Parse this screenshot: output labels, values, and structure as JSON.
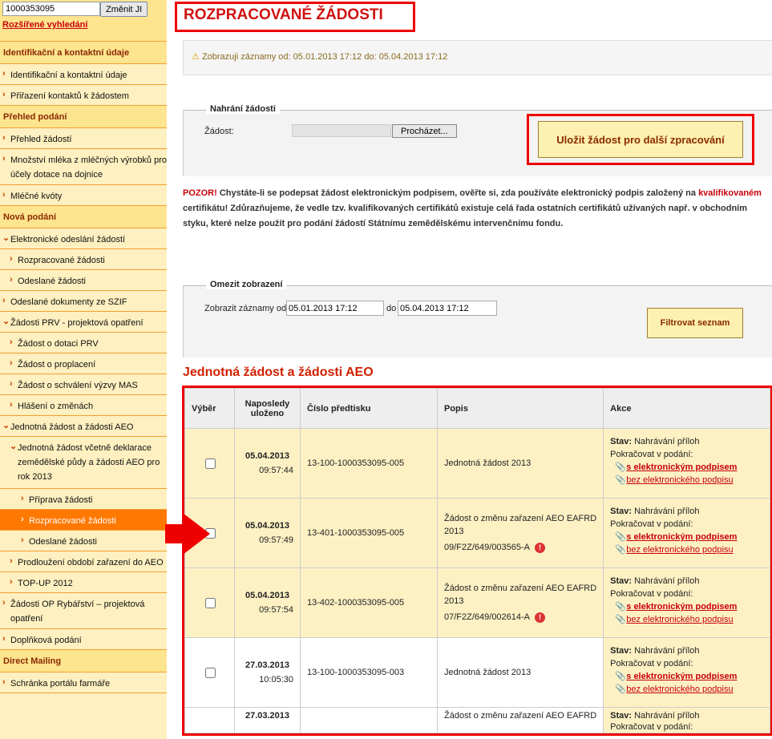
{
  "sidebar": {
    "ji_value": "1000353095",
    "change_button": "Změnit JI",
    "advanced_search": "Rozšířené vyhledání",
    "items": [
      {
        "type": "heading",
        "label": "Identifikační a kontaktní údaje"
      },
      {
        "type": "item",
        "level": 0,
        "label": "Identifikační a kontaktní údaje"
      },
      {
        "type": "item",
        "level": 0,
        "label": "Přiřazení kontaktů k žádostem"
      },
      {
        "type": "heading",
        "label": "Přehled podání"
      },
      {
        "type": "item",
        "level": 0,
        "label": "Přehled žádostí"
      },
      {
        "type": "item",
        "level": 0,
        "label": "Množství mléka z mléčných výrobků pro účely dotace na dojnice",
        "lines": 2
      },
      {
        "type": "item",
        "level": 0,
        "label": "Mléčné kvóty"
      },
      {
        "type": "heading",
        "label": "Nová podání"
      },
      {
        "type": "item",
        "level": 0,
        "label": "Elektronické odeslání žádostí",
        "expanded": true
      },
      {
        "type": "item",
        "level": 1,
        "label": "Rozpracované žádosti"
      },
      {
        "type": "item",
        "level": 1,
        "label": "Odeslané žádosti"
      },
      {
        "type": "item",
        "level": 0,
        "label": "Odeslané dokumenty ze SZIF"
      },
      {
        "type": "item",
        "level": 0,
        "label": "Žádosti PRV - projektová opatření",
        "expanded": true
      },
      {
        "type": "item",
        "level": 1,
        "label": "Žádost o dotaci PRV"
      },
      {
        "type": "item",
        "level": 1,
        "label": "Žádost o proplacení"
      },
      {
        "type": "item",
        "level": 1,
        "label": "Žádost o schválení výzvy MAS"
      },
      {
        "type": "item",
        "level": 1,
        "label": "Hlášení o změnách"
      },
      {
        "type": "item",
        "level": 0,
        "label": "Jednotná žádost a žádosti AEO",
        "expanded": true
      },
      {
        "type": "item",
        "level": 1,
        "label": "Jednotná žádost včetně deklarace zemědělské půdy a žádosti AEO pro rok 2013",
        "expanded": true,
        "lines": 3
      },
      {
        "type": "item",
        "level": 2,
        "label": "Příprava žádosti"
      },
      {
        "type": "item",
        "level": 2,
        "label": "Rozpracované žádosti",
        "active": true
      },
      {
        "type": "item",
        "level": 2,
        "label": "Odeslané žádosti"
      },
      {
        "type": "item",
        "level": 1,
        "label": "Prodloužení období zařazení do AEO"
      },
      {
        "type": "item",
        "level": 1,
        "label": "TOP-UP 2012"
      },
      {
        "type": "item",
        "level": 0,
        "label": "Žádosti OP Rybářství – projektová opatření",
        "lines": 2
      },
      {
        "type": "item",
        "level": 0,
        "label": "Doplňková podání"
      },
      {
        "type": "heading",
        "label": "Direct Mailing"
      },
      {
        "type": "item",
        "level": 0,
        "label": "Schránka portálu farmáře"
      }
    ]
  },
  "main": {
    "title": "ROZPRACOVANÉ ŽÁDOSTI",
    "info": "Zobrazuji záznamy od: 05.01.2013 17:12 do: 05.04.2013 17:12",
    "upload": {
      "legend": "Nahrání žádosti",
      "label": "Žádost:",
      "browse": "Procházet...",
      "save": "Uložit žádost pro další zpracování"
    },
    "warning": {
      "pozor": "POZOR!",
      "text1": " Chystáte-li se podepsat žádost elektronickým podpisem, ověřte si, zda používáte elektronický podpis založený na ",
      "link": "kvalifikovaném",
      "text2": " certifikátu! Zdůrazňujeme, že vedle tzv. kvalifikovaných certifikátů existuje celá řada ostatních certifikátů užívaných např. v obchodním styku, které nelze použít pro podání žádostí Státnímu zemědělskému intervenčnímu fondu."
    },
    "filter": {
      "legend": "Omezit zobrazení",
      "label": "Zobrazit záznamy od",
      "from": "05.01.2013 17:12",
      "to_label": "do",
      "to": "05.04.2013 17:12",
      "button": "Filtrovat seznam"
    },
    "section_title": "Jednotná žádost a žádosti AEO",
    "table": {
      "headers": [
        "Výběr",
        "Naposledy uloženo",
        "Číslo předtisku",
        "Popis",
        "Akce"
      ],
      "status_label": "Stav:",
      "continue_label": "Pokračovat v podání:",
      "sign_link": "s elektronickým podpisem",
      "nosign_link": "bez elektronického podpisu",
      "rows": [
        {
          "date": "05.04.2013",
          "time": "09:57:44",
          "number": "13-100-1000353095-005",
          "desc": "Jednotná žádost 2013",
          "ref": "",
          "status": "Nahrávání příloh",
          "highlight": true
        },
        {
          "date": "05.04.2013",
          "time": "09:57:49",
          "number": "13-401-1000353095-005",
          "desc": "Žádost o změnu zařazení AEO EAFRD 2013",
          "ref": "09/F2Z/649/003565-A",
          "status": "Nahrávání příloh",
          "highlight": true
        },
        {
          "date": "05.04.2013",
          "time": "09:57:54",
          "number": "13-402-1000353095-005",
          "desc": "Žádost o změnu zařazení AEO EAFRD 2013",
          "ref": "07/F2Z/649/002614-A",
          "status": "Nahrávání příloh",
          "highlight": true
        },
        {
          "date": "27.03.2013",
          "time": "10:05:30",
          "number": "13-100-1000353095-003",
          "desc": "Jednotná žádost 2013",
          "ref": "",
          "status": "Nahrávání příloh",
          "highlight": false
        },
        {
          "date": "27.03.2013",
          "time": "",
          "number": "",
          "desc": "Žádost o změnu zařazení AEO EAFRD",
          "ref": "",
          "status": "Nahrávání příloh",
          "highlight": false
        }
      ]
    }
  },
  "colors": {
    "accent_red": "#e00000",
    "active_orange": "#ff7800",
    "sidebar_bg": "#fef0c0"
  }
}
